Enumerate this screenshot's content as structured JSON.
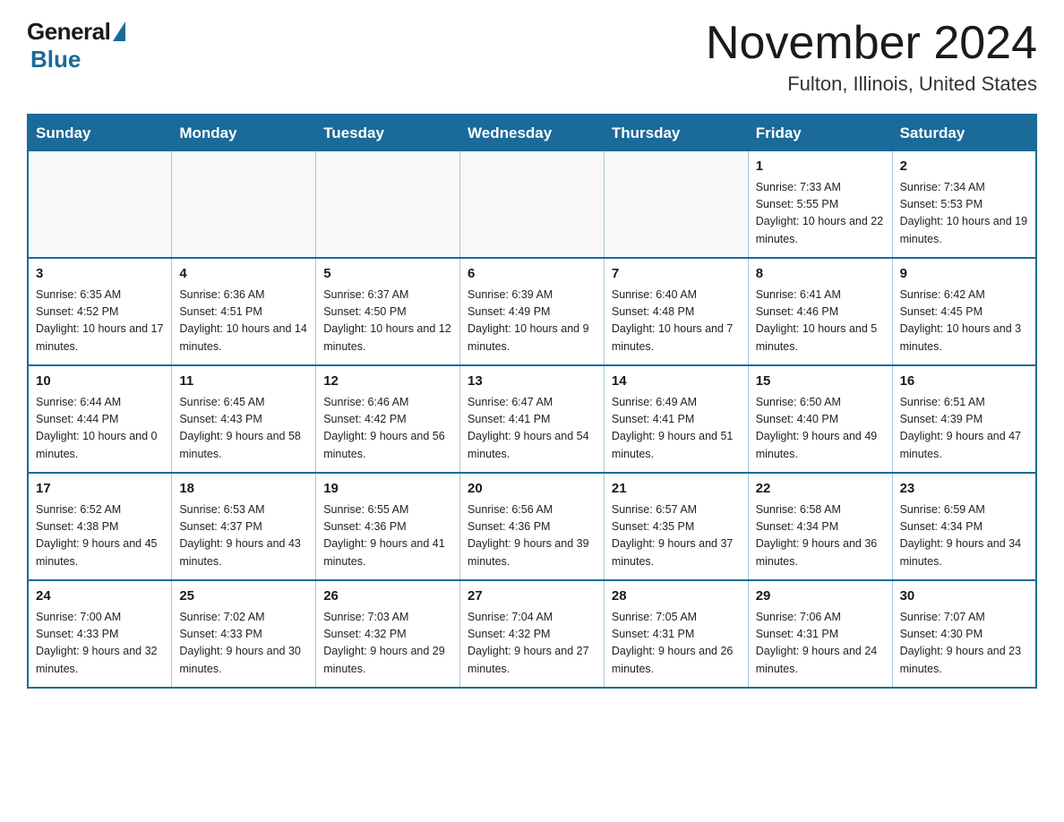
{
  "header": {
    "logo_general": "General",
    "logo_blue": "Blue",
    "month_title": "November 2024",
    "location": "Fulton, Illinois, United States"
  },
  "weekdays": [
    "Sunday",
    "Monday",
    "Tuesday",
    "Wednesday",
    "Thursday",
    "Friday",
    "Saturday"
  ],
  "weeks": [
    [
      {
        "day": "",
        "info": ""
      },
      {
        "day": "",
        "info": ""
      },
      {
        "day": "",
        "info": ""
      },
      {
        "day": "",
        "info": ""
      },
      {
        "day": "",
        "info": ""
      },
      {
        "day": "1",
        "info": "Sunrise: 7:33 AM\nSunset: 5:55 PM\nDaylight: 10 hours and 22 minutes."
      },
      {
        "day": "2",
        "info": "Sunrise: 7:34 AM\nSunset: 5:53 PM\nDaylight: 10 hours and 19 minutes."
      }
    ],
    [
      {
        "day": "3",
        "info": "Sunrise: 6:35 AM\nSunset: 4:52 PM\nDaylight: 10 hours and 17 minutes."
      },
      {
        "day": "4",
        "info": "Sunrise: 6:36 AM\nSunset: 4:51 PM\nDaylight: 10 hours and 14 minutes."
      },
      {
        "day": "5",
        "info": "Sunrise: 6:37 AM\nSunset: 4:50 PM\nDaylight: 10 hours and 12 minutes."
      },
      {
        "day": "6",
        "info": "Sunrise: 6:39 AM\nSunset: 4:49 PM\nDaylight: 10 hours and 9 minutes."
      },
      {
        "day": "7",
        "info": "Sunrise: 6:40 AM\nSunset: 4:48 PM\nDaylight: 10 hours and 7 minutes."
      },
      {
        "day": "8",
        "info": "Sunrise: 6:41 AM\nSunset: 4:46 PM\nDaylight: 10 hours and 5 minutes."
      },
      {
        "day": "9",
        "info": "Sunrise: 6:42 AM\nSunset: 4:45 PM\nDaylight: 10 hours and 3 minutes."
      }
    ],
    [
      {
        "day": "10",
        "info": "Sunrise: 6:44 AM\nSunset: 4:44 PM\nDaylight: 10 hours and 0 minutes."
      },
      {
        "day": "11",
        "info": "Sunrise: 6:45 AM\nSunset: 4:43 PM\nDaylight: 9 hours and 58 minutes."
      },
      {
        "day": "12",
        "info": "Sunrise: 6:46 AM\nSunset: 4:42 PM\nDaylight: 9 hours and 56 minutes."
      },
      {
        "day": "13",
        "info": "Sunrise: 6:47 AM\nSunset: 4:41 PM\nDaylight: 9 hours and 54 minutes."
      },
      {
        "day": "14",
        "info": "Sunrise: 6:49 AM\nSunset: 4:41 PM\nDaylight: 9 hours and 51 minutes."
      },
      {
        "day": "15",
        "info": "Sunrise: 6:50 AM\nSunset: 4:40 PM\nDaylight: 9 hours and 49 minutes."
      },
      {
        "day": "16",
        "info": "Sunrise: 6:51 AM\nSunset: 4:39 PM\nDaylight: 9 hours and 47 minutes."
      }
    ],
    [
      {
        "day": "17",
        "info": "Sunrise: 6:52 AM\nSunset: 4:38 PM\nDaylight: 9 hours and 45 minutes."
      },
      {
        "day": "18",
        "info": "Sunrise: 6:53 AM\nSunset: 4:37 PM\nDaylight: 9 hours and 43 minutes."
      },
      {
        "day": "19",
        "info": "Sunrise: 6:55 AM\nSunset: 4:36 PM\nDaylight: 9 hours and 41 minutes."
      },
      {
        "day": "20",
        "info": "Sunrise: 6:56 AM\nSunset: 4:36 PM\nDaylight: 9 hours and 39 minutes."
      },
      {
        "day": "21",
        "info": "Sunrise: 6:57 AM\nSunset: 4:35 PM\nDaylight: 9 hours and 37 minutes."
      },
      {
        "day": "22",
        "info": "Sunrise: 6:58 AM\nSunset: 4:34 PM\nDaylight: 9 hours and 36 minutes."
      },
      {
        "day": "23",
        "info": "Sunrise: 6:59 AM\nSunset: 4:34 PM\nDaylight: 9 hours and 34 minutes."
      }
    ],
    [
      {
        "day": "24",
        "info": "Sunrise: 7:00 AM\nSunset: 4:33 PM\nDaylight: 9 hours and 32 minutes."
      },
      {
        "day": "25",
        "info": "Sunrise: 7:02 AM\nSunset: 4:33 PM\nDaylight: 9 hours and 30 minutes."
      },
      {
        "day": "26",
        "info": "Sunrise: 7:03 AM\nSunset: 4:32 PM\nDaylight: 9 hours and 29 minutes."
      },
      {
        "day": "27",
        "info": "Sunrise: 7:04 AM\nSunset: 4:32 PM\nDaylight: 9 hours and 27 minutes."
      },
      {
        "day": "28",
        "info": "Sunrise: 7:05 AM\nSunset: 4:31 PM\nDaylight: 9 hours and 26 minutes."
      },
      {
        "day": "29",
        "info": "Sunrise: 7:06 AM\nSunset: 4:31 PM\nDaylight: 9 hours and 24 minutes."
      },
      {
        "day": "30",
        "info": "Sunrise: 7:07 AM\nSunset: 4:30 PM\nDaylight: 9 hours and 23 minutes."
      }
    ]
  ]
}
